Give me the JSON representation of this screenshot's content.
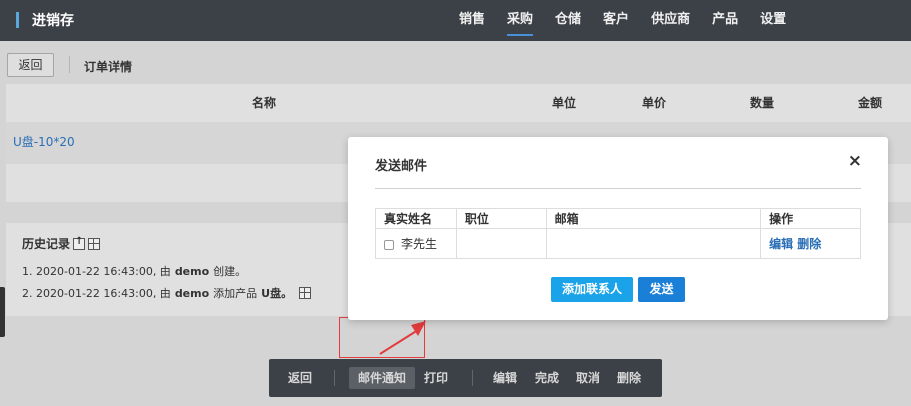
{
  "app": {
    "title": "进销存"
  },
  "nav": {
    "items": [
      "销售",
      "采购",
      "仓储",
      "客户",
      "供应商",
      "产品",
      "设置"
    ],
    "active": "采购"
  },
  "subbar": {
    "back_label": "返回",
    "title": "订单详情"
  },
  "order_table": {
    "headers": [
      "名称",
      "单位",
      "单价",
      "数量",
      "金额"
    ],
    "rows": [
      {
        "name": "U盘-10*20"
      }
    ]
  },
  "history": {
    "title": "历史记录",
    "items": [
      {
        "prefix": "1. 2020-01-22 16:43:00, 由",
        "user": "demo",
        "action": "创建。"
      },
      {
        "prefix": "2. 2020-01-22 16:43:00, 由",
        "user": "demo",
        "action": "添加产品",
        "product": "U盘。"
      }
    ]
  },
  "bottombar": {
    "back": "返回",
    "mail": "邮件通知",
    "print": "打印",
    "edit": "编辑",
    "complete": "完成",
    "cancel": "取消",
    "delete": "删除"
  },
  "modal": {
    "title": "发送邮件",
    "close": "×",
    "headers": {
      "name": "真实姓名",
      "position": "职位",
      "email": "邮箱",
      "actions": "操作"
    },
    "contacts": [
      {
        "name": "李先生",
        "position": "",
        "email": "",
        "edit": "编辑",
        "delete": "删除"
      }
    ],
    "add_button": "添加联系人",
    "send_button": "发送"
  },
  "colors": {
    "topbar": "#3b4147",
    "accent": "#1a7fd6",
    "link": "#2a6fb5",
    "highlight": "#e23b3b"
  }
}
